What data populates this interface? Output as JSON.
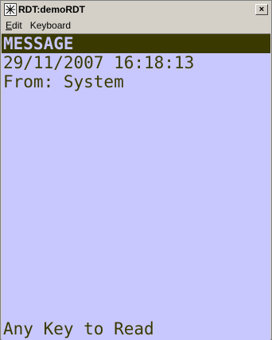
{
  "window": {
    "title": "RDT:demoRDT",
    "close_label": "×"
  },
  "menu": {
    "items": [
      {
        "label": "Edit",
        "ul": "E",
        "rest": "dit"
      },
      {
        "label": "Keyboard",
        "ul": "",
        "rest": "Keyboard"
      }
    ]
  },
  "screen": {
    "header": "MESSAGE",
    "line1": "29/11/2007 16:18:13",
    "line2": "From: System",
    "footer": "Any Key to Read"
  },
  "colors": {
    "background": "#c8c8ff",
    "text": "#3a3a00",
    "header_bg": "#3a3a00"
  }
}
